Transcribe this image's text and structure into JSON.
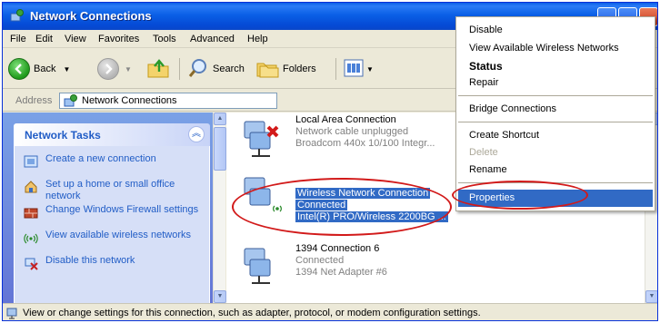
{
  "window": {
    "title": "Network Connections"
  },
  "menubar": {
    "items": [
      "File",
      "Edit",
      "View",
      "Favorites",
      "Tools",
      "Advanced",
      "Help"
    ]
  },
  "toolbar": {
    "back_label": "Back",
    "search_label": "Search",
    "folders_label": "Folders"
  },
  "address": {
    "label": "Address",
    "value": "Network Connections"
  },
  "tasks": {
    "header": "Network Tasks",
    "items": [
      {
        "label": "Create a new connection",
        "icon": "new-connection-icon"
      },
      {
        "label": "Set up a home or small office network",
        "icon": "home-network-icon"
      },
      {
        "label": "Change Windows Firewall settings",
        "icon": "firewall-icon"
      },
      {
        "label": "View available wireless networks",
        "icon": "wireless-icon"
      },
      {
        "label": "Disable this network",
        "icon": "disable-network-icon"
      }
    ]
  },
  "connections": [
    {
      "name": "Local Area Connection",
      "status": "Network cable unplugged",
      "adapter": "Broadcom 440x 10/100 Integr..."
    },
    {
      "name": "Wireless Network Connection",
      "status": "Connected",
      "adapter": "Intel(R) PRO/Wireless 2200BG ..."
    },
    {
      "name": "1394 Connection 6",
      "status": "Connected",
      "adapter": "1394 Net Adapter #6"
    }
  ],
  "context_menu": {
    "items": [
      "Disable",
      "View Available Wireless Networks",
      "Status",
      "Repair",
      "Bridge Connections",
      "Create Shortcut",
      "Delete",
      "Rename",
      "Properties"
    ]
  },
  "status_bar": {
    "text": "View or change settings for this connection, such as adapter, protocol, or modem configuration settings."
  },
  "colors": {
    "highlight": "#316ac5",
    "task_link": "#215dc6",
    "annotation": "#d21a1a"
  }
}
